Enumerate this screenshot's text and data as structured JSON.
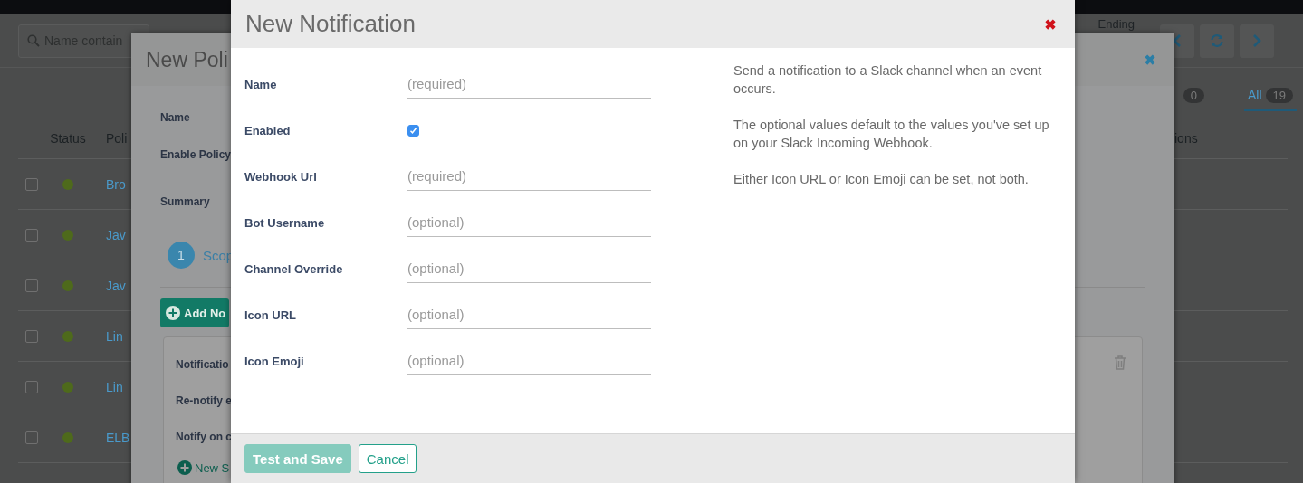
{
  "background_page": {
    "search": {
      "placeholder": "Name contain"
    },
    "header_fragment": "Ending",
    "tabs": [
      {
        "badge": "0",
        "selected": false
      },
      {
        "label": "All",
        "badge": "19",
        "selected": true
      }
    ],
    "table": {
      "columns": [
        "Status",
        "Poli"
      ],
      "column_fragment": "ions",
      "rows": [
        {
          "checked": false,
          "name": "Bro"
        },
        {
          "checked": false,
          "name": "Jav"
        },
        {
          "checked": false,
          "name": "Jav"
        },
        {
          "checked": false,
          "name": "Lin"
        },
        {
          "checked": false,
          "name": "Lin"
        },
        {
          "checked": false,
          "name": "ELB"
        }
      ]
    }
  },
  "policy_dialog": {
    "title": "New Poli",
    "labels": [
      "Name",
      "Enable Policy",
      "Summary"
    ],
    "step": {
      "number": "1",
      "label": "Scop"
    },
    "add_button": "Add No",
    "card": {
      "labels": [
        "Notificatio",
        "Re-notify e",
        "Notify on c"
      ],
      "new_button": "New S"
    }
  },
  "notification_dialog": {
    "title": "New Notification",
    "fields": [
      {
        "kind": "text",
        "label": "Name",
        "placeholder": "(required)"
      },
      {
        "kind": "checkbox",
        "label": "Enabled",
        "checked": true
      },
      {
        "kind": "text",
        "label": "Webhook Url",
        "placeholder": "(required)"
      },
      {
        "kind": "text",
        "label": "Bot Username",
        "placeholder": "(optional)"
      },
      {
        "kind": "text",
        "label": "Channel Override",
        "placeholder": "(optional)"
      },
      {
        "kind": "text",
        "label": "Icon URL",
        "placeholder": "(optional)"
      },
      {
        "kind": "text",
        "label": "Icon Emoji",
        "placeholder": "(optional)"
      }
    ],
    "help": [
      "Send a notification to a Slack channel when an event occurs.",
      "The optional values default to the values you've set up on your Slack Incoming Webhook.",
      "Either Icon URL or Icon Emoji can be set, not both."
    ],
    "buttons": [
      {
        "kind": "primary",
        "label": "Test and Save",
        "disabled": true
      },
      {
        "kind": "secondary",
        "label": "Cancel",
        "disabled": false
      }
    ]
  }
}
